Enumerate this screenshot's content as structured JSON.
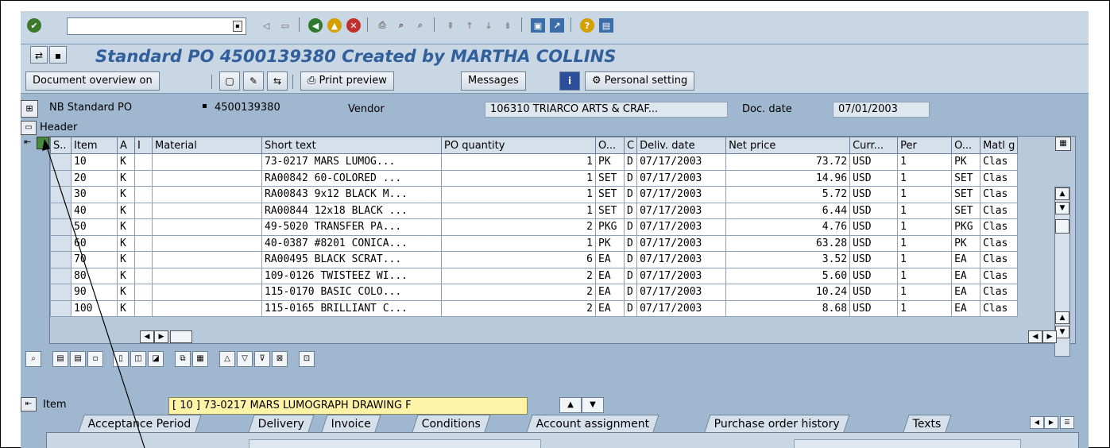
{
  "toolbar": {
    "icons": [
      "check-icon",
      "back-icon",
      "exit-icon",
      "cancel-icon",
      "print-icon",
      "find-icon",
      "find-next-icon",
      "first-page-icon",
      "prev-page-icon",
      "next-page-icon",
      "last-page-icon",
      "new-session-icon",
      "shortcut-icon",
      "help-icon",
      "layout-icon"
    ]
  },
  "title": "Standard PO 4500139380 Created by MARTHA COLLINS",
  "appbar": {
    "doc_overview": "Document overview on",
    "print_preview": "Print preview",
    "messages": "Messages",
    "personal_setting": "Personal setting"
  },
  "header": {
    "doc_type": "NB Standard PO",
    "po_number": "4500139380",
    "vendor_label": "Vendor",
    "vendor_value": "106310 TRIARCO ARTS & CRAF...",
    "doc_date_label": "Doc. date",
    "doc_date_value": "07/01/2003",
    "header_label": "Header"
  },
  "grid": {
    "columns": [
      "S..",
      "Item",
      "A",
      "I",
      "Material",
      "Short text",
      "PO quantity",
      "O...",
      "C",
      "Deliv. date",
      "Net price",
      "Curr...",
      "Per",
      "O...",
      "Matl g"
    ],
    "rows": [
      {
        "item": "10",
        "a": "K",
        "short_text": "73-0217 MARS LUMOG...",
        "qty": "1",
        "unit": "PK",
        "c": "D",
        "date": "07/17/2003",
        "price": "73.72",
        "curr": "USD",
        "per": "1",
        "ou": "PK",
        "matl": "Clas"
      },
      {
        "item": "20",
        "a": "K",
        "short_text": "RA00842 60-COLORED ...",
        "qty": "1",
        "unit": "SET",
        "c": "D",
        "date": "07/17/2003",
        "price": "14.96",
        "curr": "USD",
        "per": "1",
        "ou": "SET",
        "matl": "Clas"
      },
      {
        "item": "30",
        "a": "K",
        "short_text": "RA00843 9x12 BLACK M...",
        "qty": "1",
        "unit": "SET",
        "c": "D",
        "date": "07/17/2003",
        "price": "5.72",
        "curr": "USD",
        "per": "1",
        "ou": "SET",
        "matl": "Clas"
      },
      {
        "item": "40",
        "a": "K",
        "short_text": "RA00844 12x18 BLACK ...",
        "qty": "1",
        "unit": "SET",
        "c": "D",
        "date": "07/17/2003",
        "price": "6.44",
        "curr": "USD",
        "per": "1",
        "ou": "SET",
        "matl": "Clas"
      },
      {
        "item": "50",
        "a": "K",
        "short_text": "49-5020 TRANSFER PA...",
        "qty": "2",
        "unit": "PKG",
        "c": "D",
        "date": "07/17/2003",
        "price": "4.76",
        "curr": "USD",
        "per": "1",
        "ou": "PKG",
        "matl": "Clas"
      },
      {
        "item": "60",
        "a": "K",
        "short_text": "40-0387 #8201 CONICA...",
        "qty": "1",
        "unit": "PK",
        "c": "D",
        "date": "07/17/2003",
        "price": "63.28",
        "curr": "USD",
        "per": "1",
        "ou": "PK",
        "matl": "Clas"
      },
      {
        "item": "70",
        "a": "K",
        "short_text": "RA00495 BLACK SCRAT...",
        "qty": "6",
        "unit": "EA",
        "c": "D",
        "date": "07/17/2003",
        "price": "3.52",
        "curr": "USD",
        "per": "1",
        "ou": "EA",
        "matl": "Clas"
      },
      {
        "item": "80",
        "a": "K",
        "short_text": "109-0126 TWISTEEZ WI...",
        "qty": "2",
        "unit": "EA",
        "c": "D",
        "date": "07/17/2003",
        "price": "5.60",
        "curr": "USD",
        "per": "1",
        "ou": "EA",
        "matl": "Clas"
      },
      {
        "item": "90",
        "a": "K",
        "short_text": "115-0170 BASIC COLO...",
        "qty": "2",
        "unit": "EA",
        "c": "D",
        "date": "07/17/2003",
        "price": "10.24",
        "curr": "USD",
        "per": "1",
        "ou": "EA",
        "matl": "Clas"
      },
      {
        "item": "100",
        "a": "K",
        "short_text": "115-0165 BRILLIANT C...",
        "qty": "2",
        "unit": "EA",
        "c": "D",
        "date": "07/17/2003",
        "price": "8.68",
        "curr": "USD",
        "per": "1",
        "ou": "EA",
        "matl": "Clas"
      }
    ]
  },
  "item_area": {
    "label": "Item",
    "selected": "[ 10 ] 73-0217 MARS LUMOGRAPH DRAWING F"
  },
  "tabs": [
    "Acceptance Period",
    "Delivery",
    "Invoice",
    "Conditions",
    "Account assignment",
    "Purchase order history",
    "Texts"
  ],
  "colors": {
    "background": "#9fb8cf",
    "toolbar": "#c9d7e4",
    "title": "#315f9c",
    "item_highlight": "#fff3a8"
  }
}
